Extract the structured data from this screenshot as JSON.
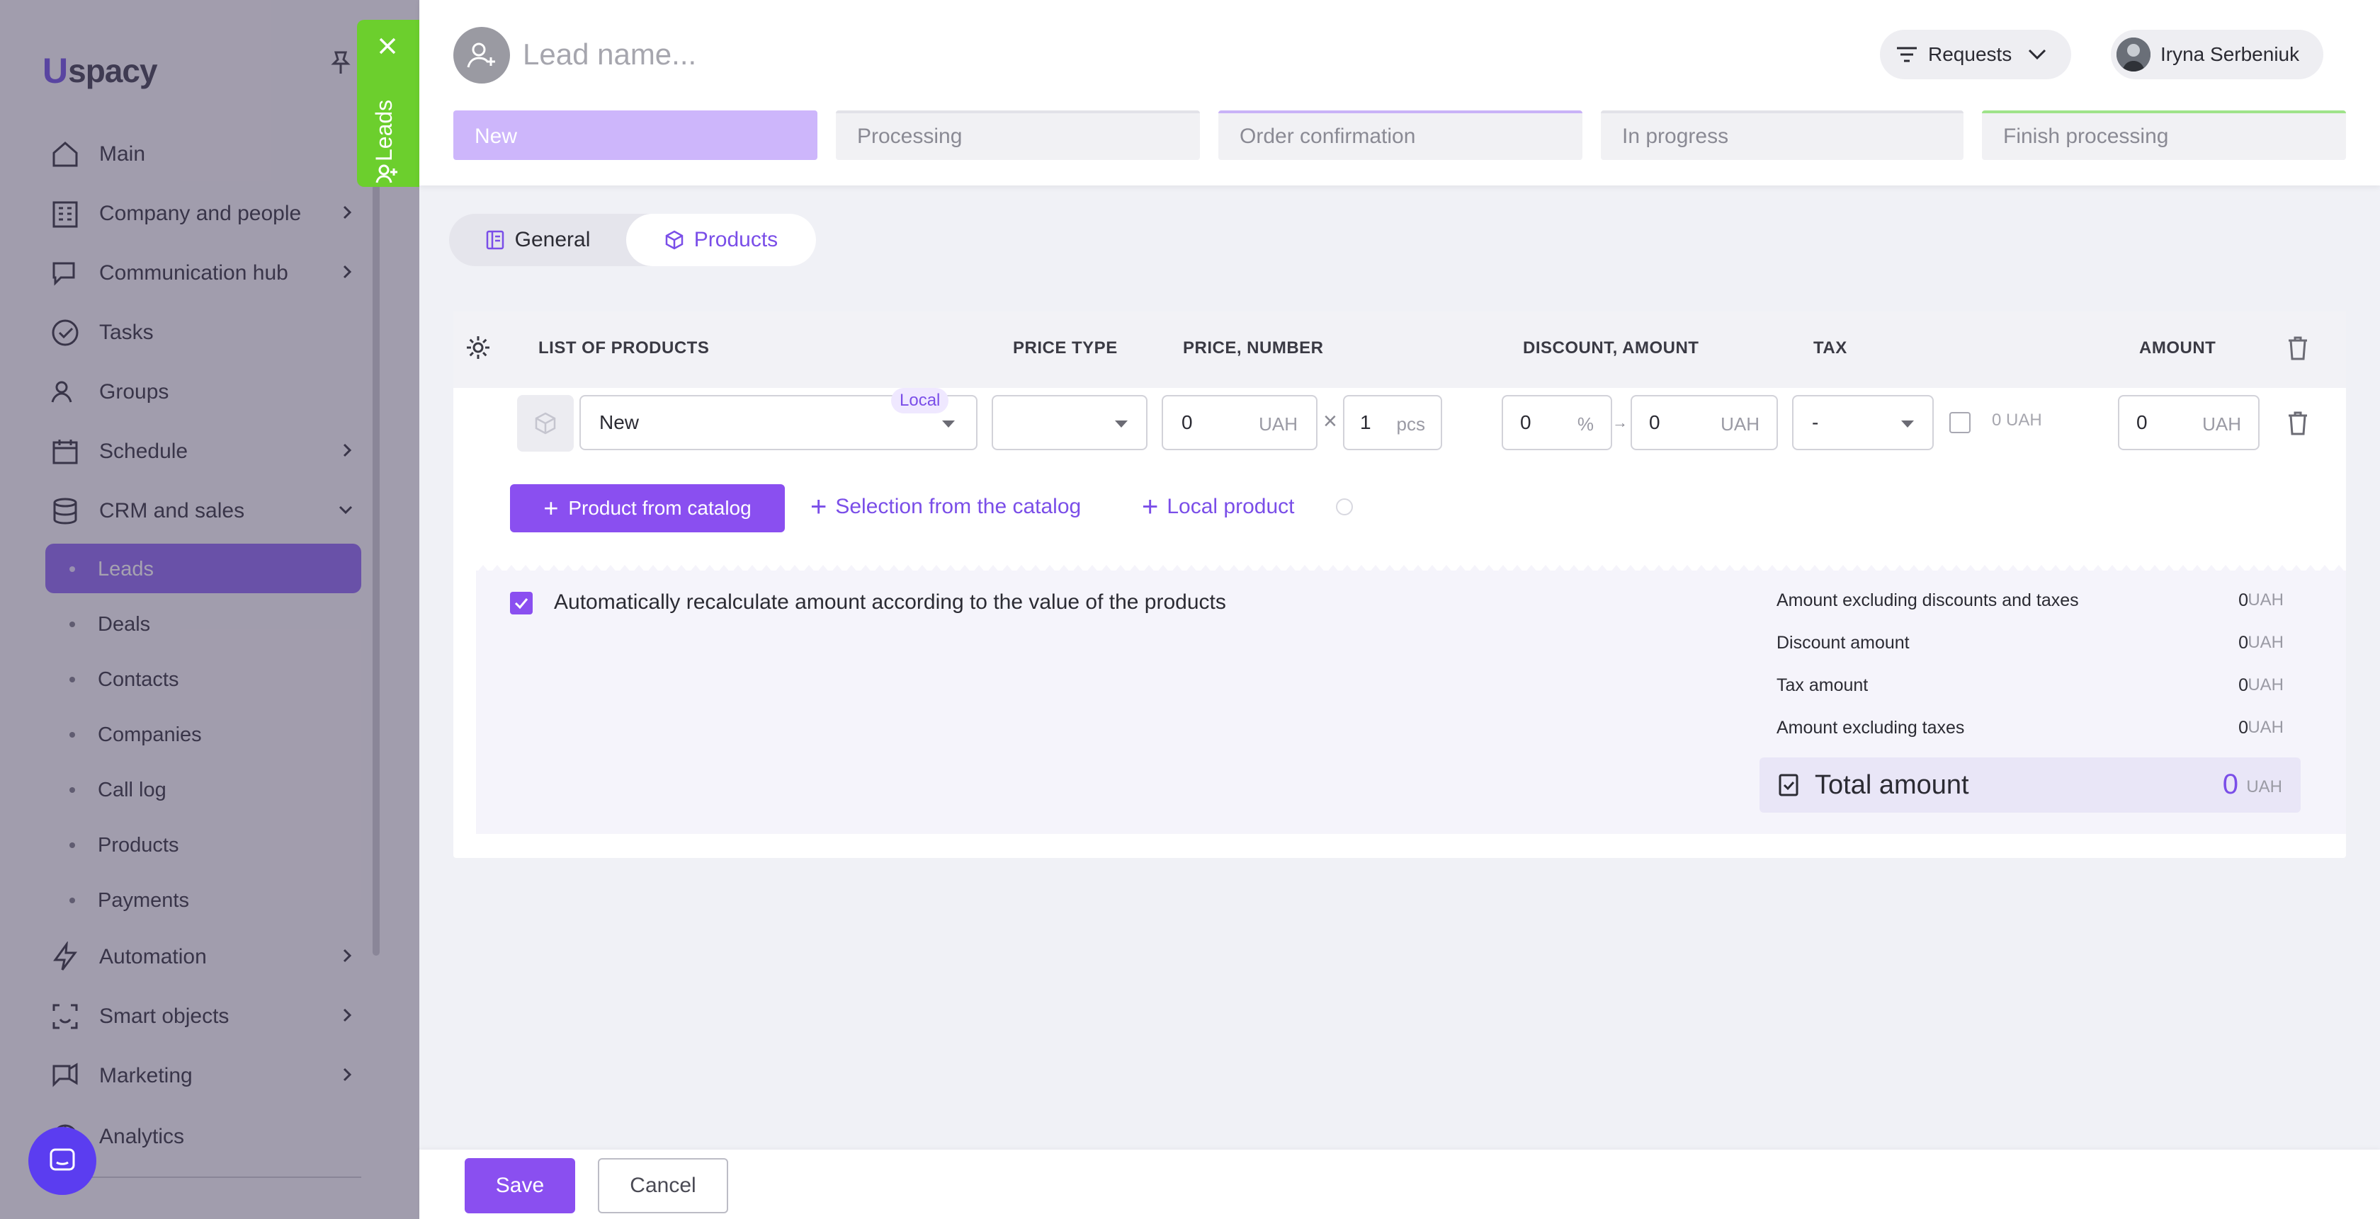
{
  "sidebar": {
    "logo": "spacy",
    "items": [
      {
        "label": "Main",
        "icon": "home-icon"
      },
      {
        "label": "Company and people",
        "icon": "building-icon"
      },
      {
        "label": "Communication hub",
        "icon": "chat-edit-icon"
      },
      {
        "label": "Tasks",
        "icon": "check-circle-icon"
      },
      {
        "label": "Groups",
        "icon": "users-icon"
      },
      {
        "label": "Schedule",
        "icon": "calendar-icon"
      },
      {
        "label": "CRM and sales",
        "icon": "database-icon"
      },
      {
        "label": "Automation",
        "icon": "bolt-icon"
      },
      {
        "label": "Smart objects",
        "icon": "scan-icon"
      },
      {
        "label": "Marketing",
        "icon": "megaphone-icon"
      },
      {
        "label": "Analytics",
        "icon": "chart-icon"
      }
    ],
    "sub_items": [
      "Leads",
      "Deals",
      "Contacts",
      "Companies",
      "Call log",
      "Products",
      "Payments"
    ]
  },
  "side_tab": {
    "label": "Leads"
  },
  "header": {
    "lead_name_placeholder": "Lead name...",
    "requests_label": "Requests",
    "user_name": "Iryna Serbeniuk"
  },
  "stages": [
    "New",
    "Processing",
    "Order confirmation",
    "In progress",
    "Finish processing"
  ],
  "stage_colors": {
    "new": "#cdb6fb",
    "order_confirmation": "#c9b3f7",
    "finish_processing": "#9fe38a"
  },
  "tabs": {
    "general": "General",
    "products": "Products"
  },
  "table": {
    "headers": [
      "LIST OF PRODUCTS",
      "PRICE TYPE",
      "PRICE, NUMBER",
      "DISCOUNT, AMOUNT",
      "TAX",
      "AMOUNT"
    ],
    "row": {
      "product": "New",
      "local_badge": "Local",
      "price": "0",
      "price_currency": "UAH",
      "quantity": "1",
      "quantity_unit": "pcs",
      "discount_percent": "0",
      "percent_sign": "%",
      "discount_amount": "0",
      "discount_currency": "UAH",
      "tax": "-",
      "tax_amount": "0",
      "tax_currency": "UAH",
      "amount": "0",
      "amount_currency": "UAH"
    }
  },
  "actions": {
    "product_from_catalog": "Product from catalog",
    "selection_from_catalog": "Selection from the catalog",
    "local_product": "Local product"
  },
  "summary": {
    "auto_recalc_label": "Automatically recalculate amount according to the value of the products",
    "rows": [
      {
        "label": "Amount excluding discounts and taxes",
        "value": "0",
        "currency": "UAH"
      },
      {
        "label": "Discount amount",
        "value": "0",
        "currency": "UAH"
      },
      {
        "label": "Tax amount",
        "value": "0",
        "currency": "UAH"
      },
      {
        "label": "Amount excluding taxes",
        "value": "0",
        "currency": "UAH"
      }
    ],
    "total_label": "Total amount",
    "total_value": "0",
    "total_currency": "UAH"
  },
  "footer": {
    "save": "Save",
    "cancel": "Cancel"
  },
  "colors": {
    "accent": "#8a4ff0",
    "leads_tab": "#6ccf2d"
  }
}
